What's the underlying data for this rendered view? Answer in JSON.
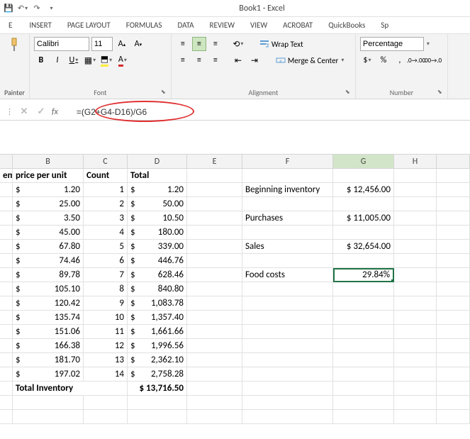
{
  "title": "Book1 - Excel",
  "ribbon_tabs": [
    "INSERT",
    "PAGE LAYOUT",
    "FORMULAS",
    "DATA",
    "REVIEW",
    "VIEW",
    "ACROBAT",
    "QuickBooks",
    "Sp"
  ],
  "file_tab": "E",
  "clipboard": {
    "painter": "Painter"
  },
  "font": {
    "name": "Calibri",
    "size": "11",
    "group_label": "Font"
  },
  "alignment": {
    "wrap": "Wrap Text",
    "merge": "Merge & Center",
    "group_label": "Alignment"
  },
  "number": {
    "format": "Percentage",
    "group_label": "Number"
  },
  "formula_bar": {
    "formula": "=(G2+G4-D16)/G6"
  },
  "columns": [
    "",
    "B",
    "C",
    "D",
    "E",
    "F",
    "G",
    "H",
    ""
  ],
  "headers": {
    "b": "price per unit",
    "c": "Count",
    "d": "Total",
    "a_stub": "em"
  },
  "rows": [
    {
      "price": "1.20",
      "count": "1",
      "total": "1.20",
      "f": "Beginning inventory",
      "g": "$ 12,456.00"
    },
    {
      "price": "25.00",
      "count": "2",
      "total": "50.00",
      "f": "",
      "g": ""
    },
    {
      "price": "3.50",
      "count": "3",
      "total": "10.50",
      "f": "Purchases",
      "g": "$ 11,005.00"
    },
    {
      "price": "45.00",
      "count": "4",
      "total": "180.00",
      "f": "",
      "g": ""
    },
    {
      "price": "67.80",
      "count": "5",
      "total": "339.00",
      "f": "Sales",
      "g": "$ 32,654.00"
    },
    {
      "price": "74.46",
      "count": "6",
      "total": "446.76",
      "f": "",
      "g": ""
    },
    {
      "price": "89.78",
      "count": "7",
      "total": "628.46",
      "f": "Food costs",
      "g": "29.84%",
      "active": true
    },
    {
      "price": "105.10",
      "count": "8",
      "total": "840.80",
      "f": "",
      "g": ""
    },
    {
      "price": "120.42",
      "count": "9",
      "total": "1,083.78",
      "f": "",
      "g": ""
    },
    {
      "price": "135.74",
      "count": "10",
      "total": "1,357.40",
      "f": "",
      "g": ""
    },
    {
      "price": "151.06",
      "count": "11",
      "total": "1,661.66",
      "f": "",
      "g": ""
    },
    {
      "price": "166.38",
      "count": "12",
      "total": "1,996.56",
      "f": "",
      "g": ""
    },
    {
      "price": "181.70",
      "count": "13",
      "total": "2,362.10",
      "f": "",
      "g": ""
    },
    {
      "price": "197.02",
      "count": "14",
      "total": "2,758.28",
      "f": "",
      "g": ""
    }
  ],
  "total_row": {
    "label": "Total Inventory",
    "value": "$ 13,716.50"
  }
}
